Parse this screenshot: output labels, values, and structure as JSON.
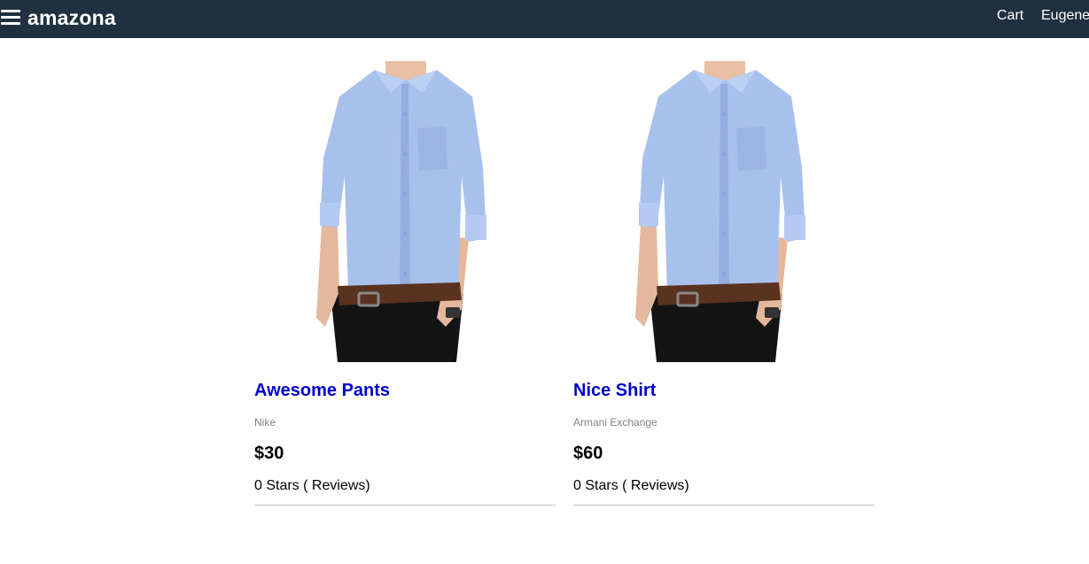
{
  "header": {
    "menu_icon": "hamburger-menu-icon",
    "brand": "amazona",
    "cart": "Cart",
    "user": "Eugene"
  },
  "products": [
    {
      "name": "Awesome Pants",
      "brand": "Nike",
      "price": "$30",
      "rating": "0 Stars ( Reviews)",
      "image": "blue-shirt-photo"
    },
    {
      "name": "Nice Shirt",
      "brand": "Armani Exchange",
      "price": "$60",
      "rating": "0 Stars ( Reviews)",
      "image": "blue-shirt-photo"
    }
  ],
  "colors": {
    "header_bg": "#203040",
    "product_link": "#0000cc",
    "brand_text": "#808080"
  }
}
